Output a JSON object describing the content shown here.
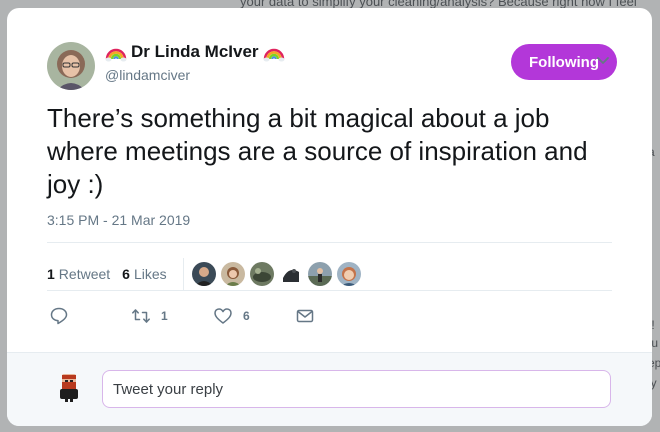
{
  "background": {
    "top_text": "your data to simplify your cleaning/analysis? Because right now I feel",
    "right_fragments": [
      "a",
      "/!",
      "fu",
      "ep",
      "ly"
    ]
  },
  "tweet": {
    "display_name": "Dr Linda McIver",
    "handle": "@lindamciver",
    "follow_label": "Following",
    "text": "There’s something a bit magical about a job where meetings are a source of inspiration and joy :)",
    "timestamp": "3:15 PM - 21 Mar 2019",
    "retweets_count": "1",
    "retweets_label": "Retweet",
    "likes_count": "6",
    "likes_label": "Likes",
    "actions": {
      "reply_count": "",
      "retweet_count": "1",
      "like_count": "6"
    }
  },
  "reply": {
    "placeholder": "Tweet your reply"
  },
  "colors": {
    "accent": "#b337d9",
    "reply_border": "#d8b6ea",
    "muted_text": "#657786"
  },
  "icons": [
    "rainbow-icon",
    "chevron-down-icon",
    "reply-icon",
    "retweet-icon",
    "like-icon",
    "message-icon"
  ]
}
